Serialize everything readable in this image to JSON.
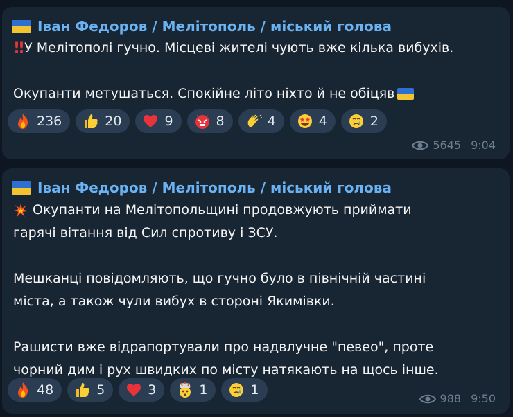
{
  "messages": [
    {
      "author": "Іван Федоров / Мелітополь / міський голова",
      "lines": [
        "У Мелітополі гучно. Місцеві жителі чують вже кілька вибухів.",
        "",
        "Окупанти метушаться. Спокійне літо ніхто й не обіцяв"
      ],
      "reactions": [
        {
          "icon": "fire-icon",
          "count": "236"
        },
        {
          "icon": "thumbs-up-icon",
          "count": "20"
        },
        {
          "icon": "red-heart-icon",
          "count": "9"
        },
        {
          "icon": "angry-face-icon",
          "count": "8"
        },
        {
          "icon": "clapping-hands-icon",
          "count": "4"
        },
        {
          "icon": "star-struck-icon",
          "count": "4"
        },
        {
          "icon": "crying-face-icon",
          "count": "2"
        }
      ],
      "views": "5645",
      "time": "9:04"
    },
    {
      "author": "Іван Федоров / Мелітополь / міський голова",
      "lines": [
        "Окупанти на Мелітопольщині продовжують приймати",
        "гарячі вітання від Сил спротиву і ЗСУ.",
        "",
        "Мешканці повідомляють, що гучно було в північній частині",
        "міста, а також чули вибух в стороні Якимівки.",
        "",
        "Рашисти вже відрапортували про надвлучне \"певео\", проте",
        "чорний дим і рух швидких по місту натякають на щось інше."
      ],
      "reactions": [
        {
          "icon": "fire-icon",
          "count": "48"
        },
        {
          "icon": "thumbs-up-icon",
          "count": "5"
        },
        {
          "icon": "red-heart-icon",
          "count": "3"
        },
        {
          "icon": "exploding-head-icon",
          "count": "1"
        },
        {
          "icon": "crying-face-icon",
          "count": "1"
        }
      ],
      "views": "988",
      "time": "9:50"
    }
  ],
  "colors": {
    "background": "#0e1621",
    "bubble": "#182533",
    "author": "#6ab2f2",
    "text": "#f5f5f5",
    "reaction_pill": "#2b3d52",
    "meta": "#6d7f8f",
    "flag_blue": "#2f6fd1",
    "flag_yellow": "#f2c530"
  }
}
